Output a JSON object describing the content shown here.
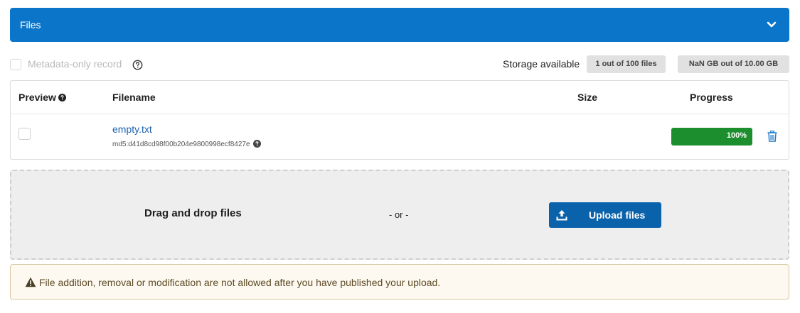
{
  "header": {
    "title": "Files",
    "chevron": "chevron-down-icon",
    "bg_color": "#0a75c9"
  },
  "metadata": {
    "checkbox_label": "Metadata-only record",
    "help_icon": "question-circle-icon"
  },
  "storage": {
    "label": "Storage available",
    "files_pill": "1 out of 100 files",
    "size_pill": "NaN GB out of 10.00 GB"
  },
  "table": {
    "headers": {
      "preview": "Preview",
      "filename": "Filename",
      "size": "Size",
      "progress": "Progress"
    },
    "rows": [
      {
        "filename": "empty.txt",
        "checksum": "md5:d41d8cd98f00b204e9800998ecf8427e",
        "size": "",
        "progress_percent": 100,
        "progress_label": "100%",
        "progress_color": "#1c8e2d",
        "delete_icon": "trash-icon"
      }
    ]
  },
  "dropzone": {
    "text": "Drag and drop files",
    "or_text": "- or -",
    "upload_button": "Upload files",
    "upload_icon": "upload-icon",
    "button_color": "#0a62ab"
  },
  "warning": {
    "icon": "warning-triangle-icon",
    "text": "File addition, removal or modification are not allowed after you have published your upload."
  }
}
